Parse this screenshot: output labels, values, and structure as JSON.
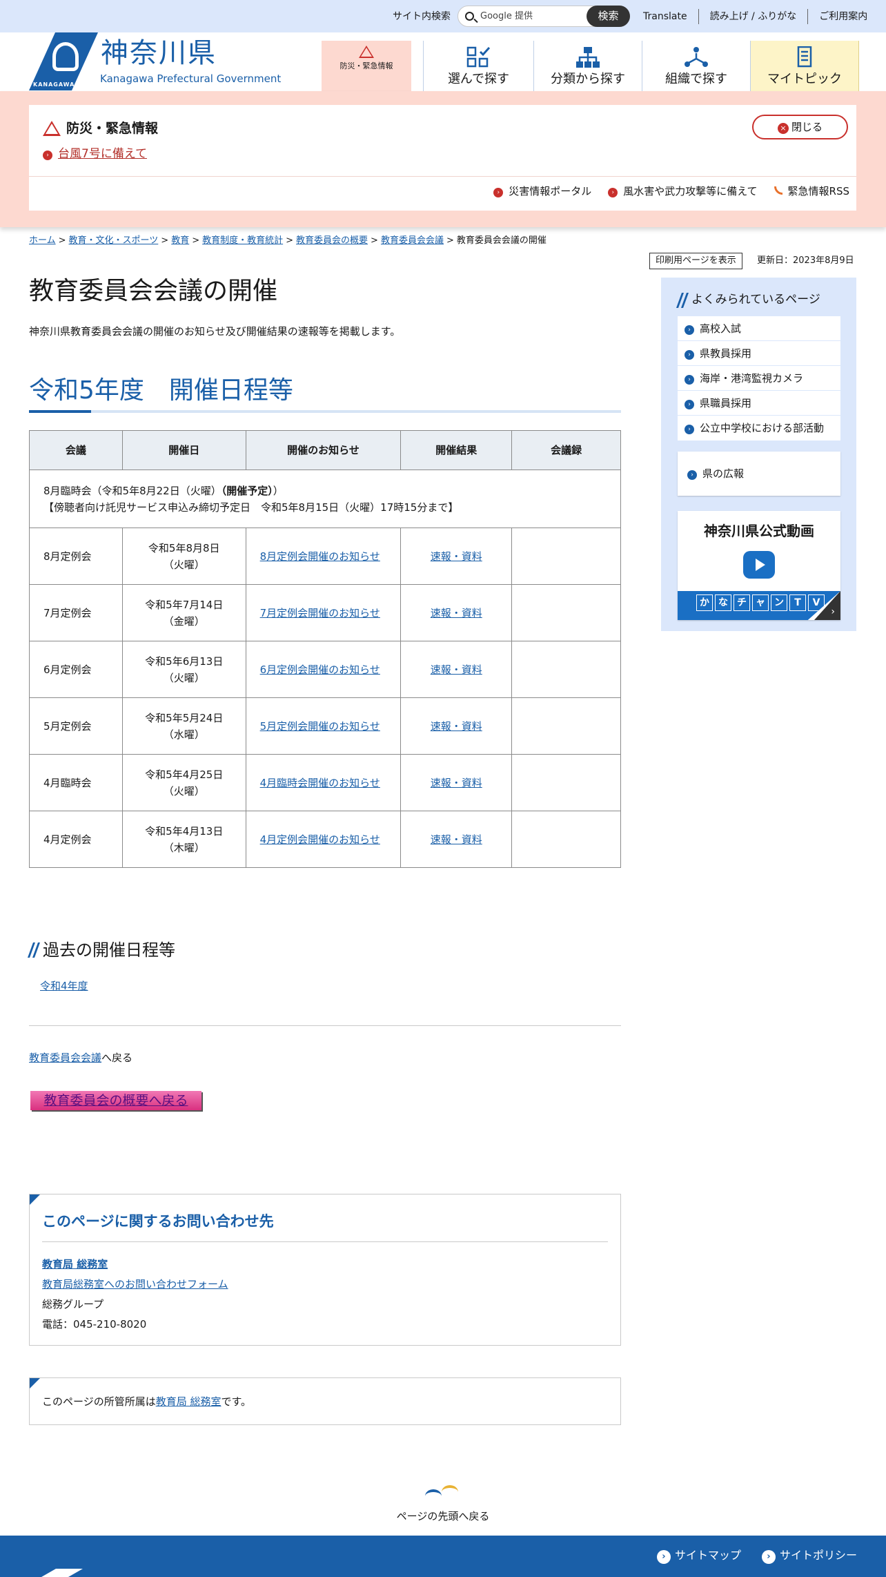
{
  "topbar": {
    "search_label": "サイト内検索",
    "search_placeholder": "Google 提供",
    "search_button": "検索",
    "links": [
      "Translate",
      "読み上げ / ふりがな",
      "ご利用案内"
    ]
  },
  "header": {
    "logo_small": "KANAGAWA",
    "logo_jp": "神奈川県",
    "logo_en": "Kanagawa Prefectural Government",
    "nav": {
      "emergency": "防災・緊急情報",
      "select": "選んで探す",
      "category": "分類から探す",
      "org": "組織で探す",
      "mytopic": "マイトピック"
    }
  },
  "emergency": {
    "title": "防災・緊急情報",
    "link": "台風7号に備えて",
    "close": "閉じる",
    "links": [
      "災害情報ポータル",
      "風水害や武力攻撃等に備えて",
      "緊急情報RSS"
    ]
  },
  "breadcrumb": {
    "items": [
      "ホーム",
      "教育・文化・スポーツ",
      "教育",
      "教育制度・教育統計",
      "教育委員会の概要",
      "教育委員会会議"
    ],
    "current": "教育委員会会議の開催"
  },
  "page": {
    "print_button": "印刷用ページを表示",
    "updated": "更新日：2023年8月9日",
    "title": "教育委員会会議の開催",
    "lead": "神奈川県教育委員会会議の開催のお知らせ及び開催結果の速報等を掲載します。",
    "section_title": "令和5年度　開催日程等"
  },
  "table": {
    "headers": [
      "会議",
      "開催日",
      "開催のお知らせ",
      "開催結果",
      "会議録"
    ],
    "note_line1_prefix": "8月臨時会（令和5年8月22日（火曜）",
    "note_line1_bold": "（開催予定）",
    "note_line1_suffix": "）",
    "note_line2": "【傍聴者向け託児サービス申込み締切予定日　令和5年8月15日（火曜）17時15分まで】",
    "rows": [
      {
        "meeting": "8月定例会",
        "date1": "令和5年8月8日",
        "date2": "（火曜）",
        "notice": "8月定例会開催のお知らせ",
        "result": "速報・資料",
        "minutes": ""
      },
      {
        "meeting": "7月定例会",
        "date1": "令和5年7月14日",
        "date2": "（金曜）",
        "notice": "7月定例会開催のお知らせ",
        "result": "速報・資料",
        "minutes": ""
      },
      {
        "meeting": "6月定例会",
        "date1": "令和5年6月13日",
        "date2": "（火曜）",
        "notice": "6月定例会開催のお知らせ",
        "result": "速報・資料",
        "minutes": ""
      },
      {
        "meeting": "5月定例会",
        "date1": "令和5年5月24日",
        "date2": "（水曜）",
        "notice": "5月定例会開催のお知らせ",
        "result": "速報・資料",
        "minutes": ""
      },
      {
        "meeting": "4月臨時会",
        "date1": "令和5年4月25日",
        "date2": "（火曜）",
        "notice": "4月臨時会開催のお知らせ",
        "result": "速報・資料",
        "minutes": ""
      },
      {
        "meeting": "4月定例会",
        "date1": "令和5年4月13日",
        "date2": "（木曜）",
        "notice": "4月定例会開催のお知らせ",
        "result": "速報・資料",
        "minutes": ""
      }
    ]
  },
  "past": {
    "title": "過去の開催日程等",
    "link": "令和4年度"
  },
  "back": {
    "link": "教育委員会会議",
    "suffix": "へ戻る",
    "button": "教育委員会の概要へ戻る"
  },
  "contact": {
    "title": "このページに関するお問い合わせ先",
    "dept": "教育局 総務室",
    "form": "教育局総務室へのお問い合わせフォーム",
    "group": "総務グループ",
    "phone": "電話：045-210-8020"
  },
  "owner": {
    "prefix": "このページの所管所属は",
    "link": "教育局 総務室",
    "suffix": "です。"
  },
  "sidebar": {
    "title": "よくみられているページ",
    "items": [
      "高校入試",
      "県教員採用",
      "海岸・港湾監視カメラ",
      "県職員採用",
      "公立中学校における部活動"
    ],
    "koho": "県の広報",
    "video_title": "神奈川県公式動画",
    "tv_chars": [
      "か",
      "な",
      "チ",
      "ャ",
      "ン",
      "T",
      "V"
    ]
  },
  "totop": "ページの先頭へ戻る",
  "footer": {
    "sitemap": "サイトマップ",
    "policy": "サイトポリシー"
  }
}
